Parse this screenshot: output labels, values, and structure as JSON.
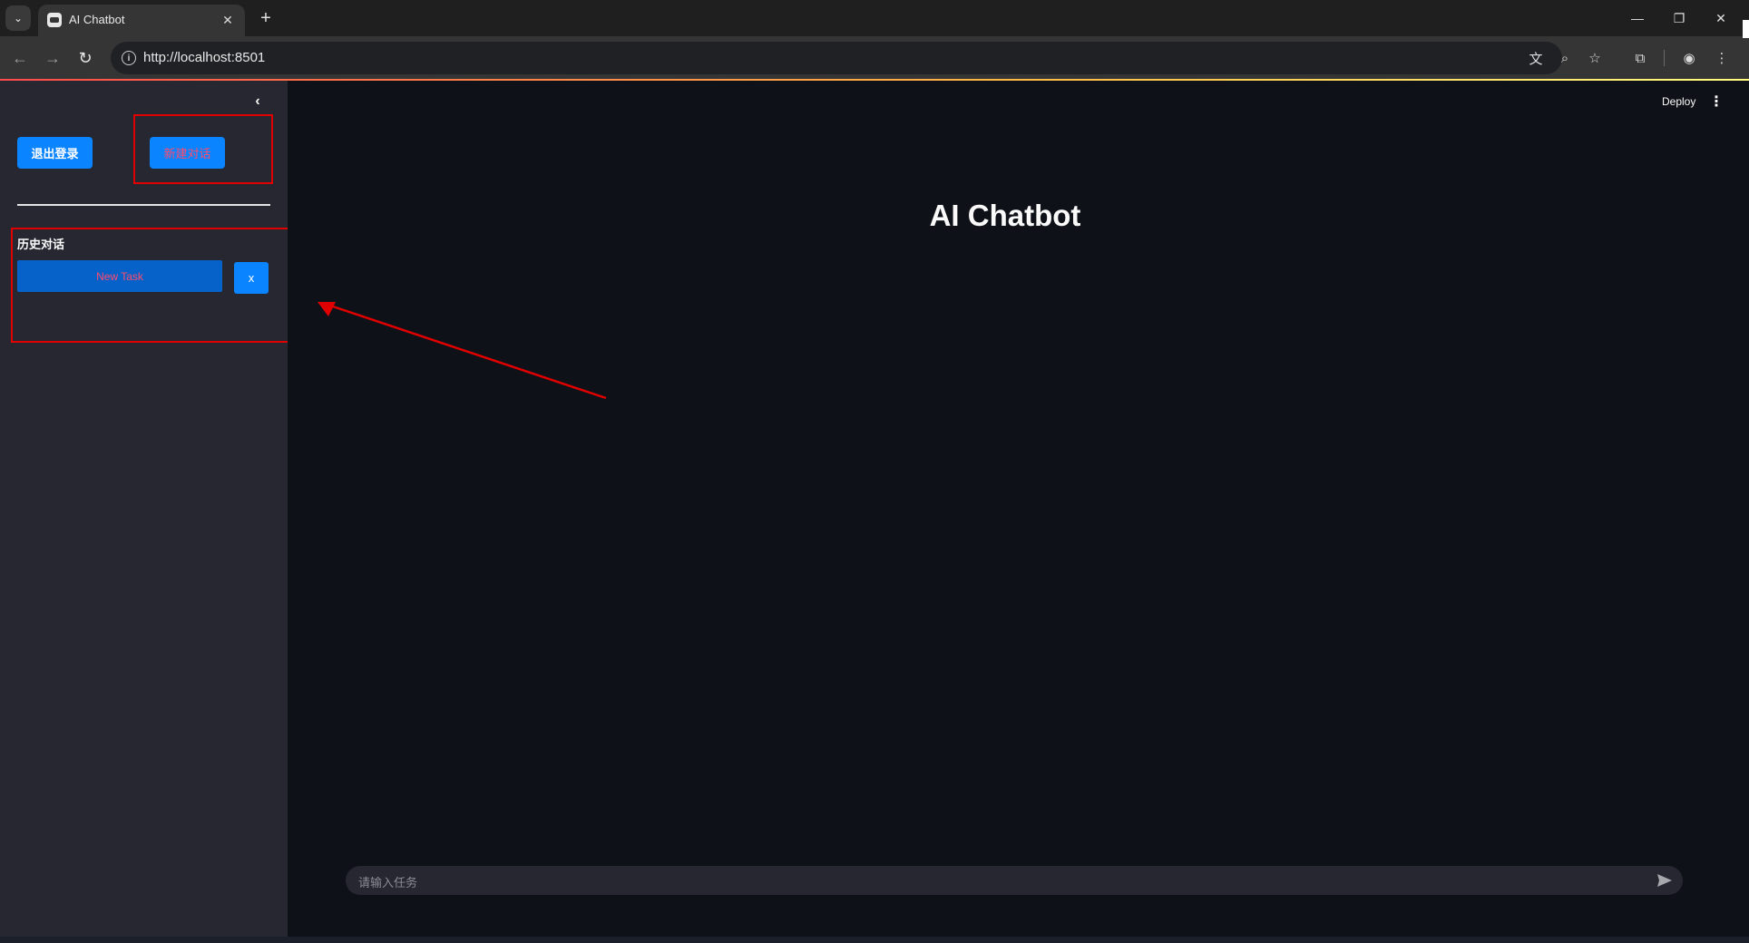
{
  "browser": {
    "tab_title": "AI Chatbot",
    "url": "http://localhost:8501",
    "new_tab": "+",
    "tab_close": "✕",
    "minimize": "—",
    "restore": "❐",
    "close": "✕"
  },
  "sidebar": {
    "collapse_icon": "‹",
    "logout_label": "退出登录",
    "new_chat_label": "新建对话",
    "history_title": "历史对话",
    "history_items": [
      {
        "label": "New Task",
        "delete_label": "x"
      }
    ]
  },
  "main": {
    "deploy_label": "Deploy",
    "menu_icon": "⋮",
    "title": "AI Chatbot",
    "chat_placeholder": "请输入任务"
  },
  "colors": {
    "sidebar_bg": "#262730",
    "main_bg": "#0e1117",
    "primary_button": "#0a84ff",
    "annotation_red": "#e00000"
  },
  "icons": [
    "search-icon",
    "back-icon",
    "forward-icon",
    "reload-icon",
    "info-icon",
    "translate-icon",
    "zoom-icon",
    "star-icon",
    "extensions-icon",
    "profile-icon",
    "menu-icon",
    "send-icon",
    "chevron-left-icon"
  ]
}
